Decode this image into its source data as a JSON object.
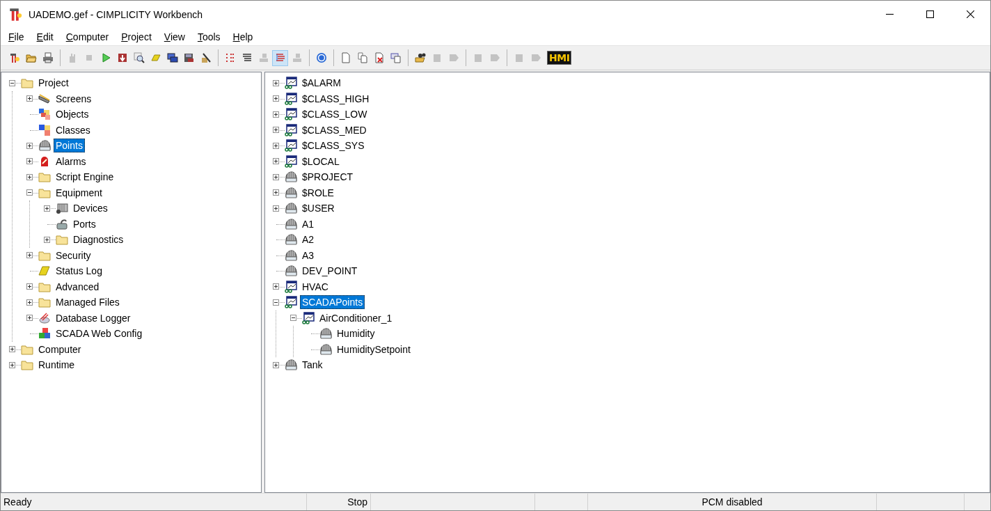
{
  "window": {
    "title": "UADEMO.gef - CIMPLICITY Workbench"
  },
  "menu": [
    "File",
    "Edit",
    "Computer",
    "Project",
    "View",
    "Tools",
    "Help"
  ],
  "toolbar": [
    {
      "kind": "wand",
      "disabled": false,
      "pressed": false
    },
    {
      "kind": "open",
      "disabled": false,
      "pressed": false
    },
    {
      "kind": "printer",
      "disabled": false,
      "pressed": false
    },
    {
      "kind": "separator"
    },
    {
      "kind": "hand",
      "disabled": true,
      "pressed": false
    },
    {
      "kind": "stop",
      "disabled": true,
      "pressed": false
    },
    {
      "kind": "play",
      "disabled": false,
      "pressed": false
    },
    {
      "kind": "download",
      "disabled": false,
      "pressed": false
    },
    {
      "kind": "magnifier",
      "disabled": false,
      "pressed": false
    },
    {
      "kind": "log",
      "disabled": false,
      "pressed": false
    },
    {
      "kind": "monitor",
      "disabled": false,
      "pressed": false
    },
    {
      "kind": "save",
      "disabled": false,
      "pressed": false
    },
    {
      "kind": "tools",
      "disabled": false,
      "pressed": false
    },
    {
      "kind": "separator"
    },
    {
      "kind": "dots",
      "disabled": false,
      "pressed": false
    },
    {
      "kind": "lines",
      "disabled": false,
      "pressed": false
    },
    {
      "kind": "node",
      "disabled": true,
      "pressed": false
    },
    {
      "kind": "tree",
      "disabled": false,
      "pressed": true
    },
    {
      "kind": "node",
      "disabled": true,
      "pressed": false
    },
    {
      "kind": "separator"
    },
    {
      "kind": "help",
      "disabled": false,
      "pressed": false
    },
    {
      "kind": "separator"
    },
    {
      "kind": "page",
      "disabled": false,
      "pressed": false
    },
    {
      "kind": "pages",
      "disabled": false,
      "pressed": false
    },
    {
      "kind": "page-delete",
      "disabled": false,
      "pressed": false
    },
    {
      "kind": "page-props",
      "disabled": false,
      "pressed": false
    },
    {
      "kind": "separator"
    },
    {
      "kind": "binoculars",
      "disabled": false,
      "pressed": false
    },
    {
      "kind": "block",
      "disabled": true,
      "pressed": false
    },
    {
      "kind": "block-arrow",
      "disabled": true,
      "pressed": false
    },
    {
      "kind": "separator"
    },
    {
      "kind": "block",
      "disabled": true,
      "pressed": false
    },
    {
      "kind": "block-arrow",
      "disabled": true,
      "pressed": false
    },
    {
      "kind": "separator"
    },
    {
      "kind": "block",
      "disabled": true,
      "pressed": false
    },
    {
      "kind": "block-arrow",
      "disabled": true,
      "pressed": false
    },
    {
      "kind": "badge",
      "label": "HMI",
      "disabled": false,
      "pressed": false
    }
  ],
  "left_tree": [
    {
      "label": "Project",
      "kind": "folder",
      "expanded": true,
      "selected": false,
      "children": [
        {
          "label": "Screens",
          "kind": "screens",
          "expanded": false,
          "selected": false
        },
        {
          "label": "Objects",
          "kind": "objects",
          "selected": false
        },
        {
          "label": "Classes",
          "kind": "classes",
          "selected": false
        },
        {
          "label": "Points",
          "kind": "points",
          "expanded": false,
          "selected": true
        },
        {
          "label": "Alarms",
          "kind": "alarms",
          "expanded": false,
          "selected": false
        },
        {
          "label": "Script Engine",
          "kind": "folder",
          "expanded": false,
          "selected": false
        },
        {
          "label": "Equipment",
          "kind": "folder",
          "expanded": true,
          "selected": false,
          "children": [
            {
              "label": "Devices",
              "kind": "devices",
              "expanded": false,
              "selected": false
            },
            {
              "label": "Ports",
              "kind": "ports",
              "selected": false
            },
            {
              "label": "Diagnostics",
              "kind": "folder",
              "expanded": false,
              "selected": false
            }
          ]
        },
        {
          "label": "Security",
          "kind": "folder",
          "expanded": false,
          "selected": false
        },
        {
          "label": "Status Log",
          "kind": "log",
          "selected": false
        },
        {
          "label": "Advanced",
          "kind": "folder",
          "expanded": false,
          "selected": false
        },
        {
          "label": "Managed Files",
          "kind": "folder",
          "expanded": false,
          "selected": false
        },
        {
          "label": "Database Logger",
          "kind": "dblogger",
          "expanded": false,
          "selected": false
        },
        {
          "label": "SCADA Web Config",
          "kind": "webconfig",
          "selected": false
        }
      ]
    },
    {
      "label": "Computer",
      "kind": "folder",
      "expanded": false,
      "selected": false
    },
    {
      "label": "Runtime",
      "kind": "folder",
      "expanded": false,
      "selected": false
    }
  ],
  "right_tree": [
    {
      "label": "$ALARM",
      "kind": "structure",
      "expanded": false,
      "selected": false
    },
    {
      "label": "$CLASS_HIGH",
      "kind": "structure",
      "expanded": false,
      "selected": false
    },
    {
      "label": "$CLASS_LOW",
      "kind": "structure",
      "expanded": false,
      "selected": false
    },
    {
      "label": "$CLASS_MED",
      "kind": "structure",
      "expanded": false,
      "selected": false
    },
    {
      "label": "$CLASS_SYS",
      "kind": "structure",
      "expanded": false,
      "selected": false
    },
    {
      "label": "$LOCAL",
      "kind": "structure",
      "expanded": false,
      "selected": false
    },
    {
      "label": "$PROJECT",
      "kind": "points",
      "expanded": false,
      "selected": false
    },
    {
      "label": "$ROLE",
      "kind": "points",
      "expanded": false,
      "selected": false
    },
    {
      "label": "$USER",
      "kind": "points",
      "expanded": false,
      "selected": false
    },
    {
      "label": "A1",
      "kind": "points",
      "selected": false
    },
    {
      "label": "A2",
      "kind": "points",
      "selected": false
    },
    {
      "label": "A3",
      "kind": "points",
      "selected": false
    },
    {
      "label": "DEV_POINT",
      "kind": "points",
      "selected": false
    },
    {
      "label": "HVAC",
      "kind": "structure",
      "expanded": false,
      "selected": false
    },
    {
      "label": "SCADAPoints",
      "kind": "structure",
      "expanded": true,
      "selected": true,
      "children": [
        {
          "label": "AirConditioner_1",
          "kind": "structure",
          "expanded": true,
          "selected": false,
          "children": [
            {
              "label": "Humidity",
              "kind": "points",
              "selected": false
            },
            {
              "label": "HumiditySetpoint",
              "kind": "points",
              "selected": false
            }
          ]
        }
      ]
    },
    {
      "label": "Tank",
      "kind": "points",
      "expanded": false,
      "selected": false
    }
  ],
  "status_bar": [
    "Ready",
    "Stop",
    "PCM disabled"
  ]
}
